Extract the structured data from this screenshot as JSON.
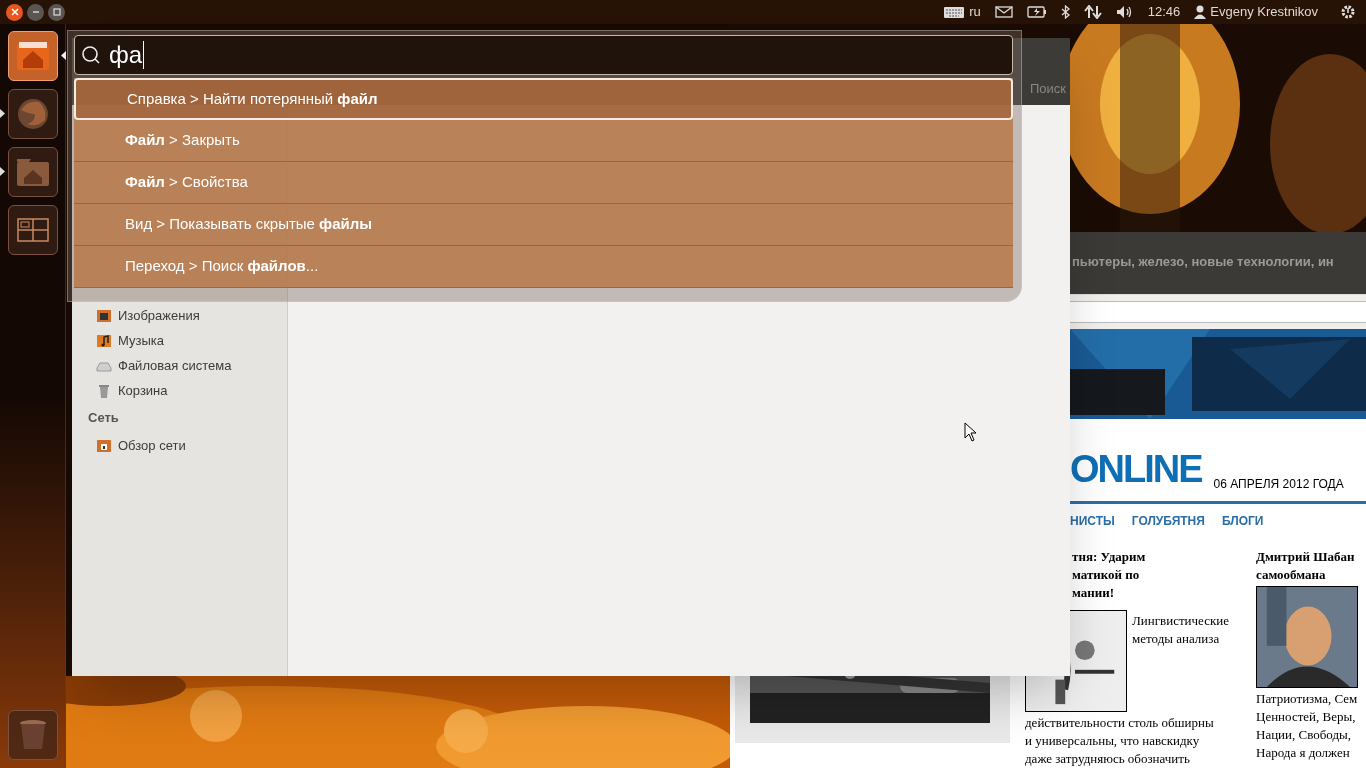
{
  "top_panel": {
    "keyboard_layout": "ru",
    "clock": "12:46",
    "user": "Evgeny Krestnikov"
  },
  "launcher": {
    "items": [
      {
        "kind": "home",
        "running": false,
        "focused": true
      },
      {
        "kind": "browser",
        "running": true,
        "focused": false
      },
      {
        "kind": "files",
        "running": true,
        "focused": false
      },
      {
        "kind": "workspaces",
        "running": false,
        "focused": false
      }
    ],
    "bottom_items": [
      {
        "kind": "trash",
        "running": false,
        "focused": false
      }
    ]
  },
  "hud": {
    "query": "фа",
    "results": [
      {
        "text": "Справка > Найти потерянный **файл**",
        "selected": true
      },
      {
        "text": "**Файл** > Закрыть",
        "selected": false
      },
      {
        "text": "**Файл** > Свойства",
        "selected": false
      },
      {
        "text": "Вид > Показывать скрытые **файлы**",
        "selected": false
      },
      {
        "text": "Переход > Поиск **файлов**...",
        "selected": false
      }
    ]
  },
  "file_manager": {
    "search_label": "Поиск",
    "sidebar": [
      {
        "kind": "pictures",
        "label": "Изображения"
      },
      {
        "kind": "music",
        "label": "Музыка"
      },
      {
        "kind": "drive",
        "label": "Файловая система"
      },
      {
        "kind": "trash",
        "label": "Корзина"
      },
      {
        "kind": "heading",
        "label": "Сеть"
      },
      {
        "kind": "network",
        "label": "Обзор сети"
      }
    ]
  },
  "browser": {
    "tagline": "пьютеры, железо, новые технологии, ин",
    "logo": "ONLINE",
    "date": "06 АПРЕЛЯ 2012 ГОДА",
    "nav": [
      "НИСТЫ",
      "ГОЛУБЯТНЯ",
      "БЛОГИ"
    ],
    "articles": [
      {
        "title_lines": [
          "тня: Ударим",
          "матикой по",
          "мании!"
        ],
        "lead_lines": [
          "Лингвистические",
          "методы анализа"
        ],
        "body_lines": [
          "действительности столь обширны",
          "и универсальны, что навскидку",
          "даже затрудняюсь обозначить"
        ]
      },
      {
        "title_lines": [
          "Дмитрий Шабан",
          "самообмана"
        ],
        "body_lines": [
          "Патриотизма, Сем",
          "Ценностей, Веры,",
          "Нации, Свободы,",
          "Народа я должен"
        ]
      }
    ]
  }
}
